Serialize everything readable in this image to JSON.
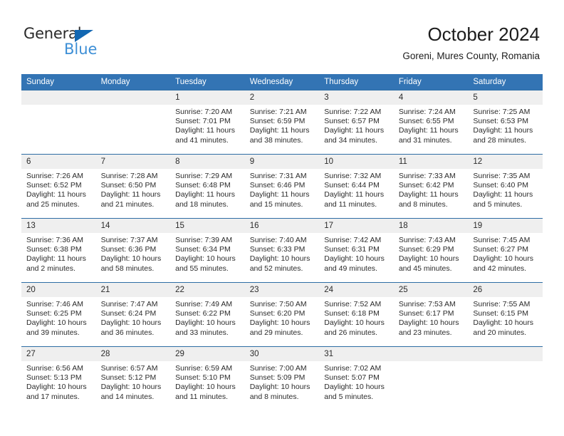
{
  "brand": {
    "name_part1": "General",
    "name_part2": "Blue",
    "triangle_color": "#1267b2",
    "blue_color": "#3d8fd6"
  },
  "header": {
    "title": "October 2024",
    "location": "Goreni, Mures County, Romania"
  },
  "theme": {
    "header_bg": "#3374b4",
    "row_border": "#2e6da4",
    "daynum_bg": "#efefef",
    "text": "#2b2b2b"
  },
  "weekday_headers": [
    "Sunday",
    "Monday",
    "Tuesday",
    "Wednesday",
    "Thursday",
    "Friday",
    "Saturday"
  ],
  "weeks": [
    [
      {
        "day": "",
        "lines": []
      },
      {
        "day": "",
        "lines": []
      },
      {
        "day": "1",
        "lines": [
          "Sunrise: 7:20 AM",
          "Sunset: 7:01 PM",
          "Daylight: 11 hours",
          "and 41 minutes."
        ]
      },
      {
        "day": "2",
        "lines": [
          "Sunrise: 7:21 AM",
          "Sunset: 6:59 PM",
          "Daylight: 11 hours",
          "and 38 minutes."
        ]
      },
      {
        "day": "3",
        "lines": [
          "Sunrise: 7:22 AM",
          "Sunset: 6:57 PM",
          "Daylight: 11 hours",
          "and 34 minutes."
        ]
      },
      {
        "day": "4",
        "lines": [
          "Sunrise: 7:24 AM",
          "Sunset: 6:55 PM",
          "Daylight: 11 hours",
          "and 31 minutes."
        ]
      },
      {
        "day": "5",
        "lines": [
          "Sunrise: 7:25 AM",
          "Sunset: 6:53 PM",
          "Daylight: 11 hours",
          "and 28 minutes."
        ]
      }
    ],
    [
      {
        "day": "6",
        "lines": [
          "Sunrise: 7:26 AM",
          "Sunset: 6:52 PM",
          "Daylight: 11 hours",
          "and 25 minutes."
        ]
      },
      {
        "day": "7",
        "lines": [
          "Sunrise: 7:28 AM",
          "Sunset: 6:50 PM",
          "Daylight: 11 hours",
          "and 21 minutes."
        ]
      },
      {
        "day": "8",
        "lines": [
          "Sunrise: 7:29 AM",
          "Sunset: 6:48 PM",
          "Daylight: 11 hours",
          "and 18 minutes."
        ]
      },
      {
        "day": "9",
        "lines": [
          "Sunrise: 7:31 AM",
          "Sunset: 6:46 PM",
          "Daylight: 11 hours",
          "and 15 minutes."
        ]
      },
      {
        "day": "10",
        "lines": [
          "Sunrise: 7:32 AM",
          "Sunset: 6:44 PM",
          "Daylight: 11 hours",
          "and 11 minutes."
        ]
      },
      {
        "day": "11",
        "lines": [
          "Sunrise: 7:33 AM",
          "Sunset: 6:42 PM",
          "Daylight: 11 hours",
          "and 8 minutes."
        ]
      },
      {
        "day": "12",
        "lines": [
          "Sunrise: 7:35 AM",
          "Sunset: 6:40 PM",
          "Daylight: 11 hours",
          "and 5 minutes."
        ]
      }
    ],
    [
      {
        "day": "13",
        "lines": [
          "Sunrise: 7:36 AM",
          "Sunset: 6:38 PM",
          "Daylight: 11 hours",
          "and 2 minutes."
        ]
      },
      {
        "day": "14",
        "lines": [
          "Sunrise: 7:37 AM",
          "Sunset: 6:36 PM",
          "Daylight: 10 hours",
          "and 58 minutes."
        ]
      },
      {
        "day": "15",
        "lines": [
          "Sunrise: 7:39 AM",
          "Sunset: 6:34 PM",
          "Daylight: 10 hours",
          "and 55 minutes."
        ]
      },
      {
        "day": "16",
        "lines": [
          "Sunrise: 7:40 AM",
          "Sunset: 6:33 PM",
          "Daylight: 10 hours",
          "and 52 minutes."
        ]
      },
      {
        "day": "17",
        "lines": [
          "Sunrise: 7:42 AM",
          "Sunset: 6:31 PM",
          "Daylight: 10 hours",
          "and 49 minutes."
        ]
      },
      {
        "day": "18",
        "lines": [
          "Sunrise: 7:43 AM",
          "Sunset: 6:29 PM",
          "Daylight: 10 hours",
          "and 45 minutes."
        ]
      },
      {
        "day": "19",
        "lines": [
          "Sunrise: 7:45 AM",
          "Sunset: 6:27 PM",
          "Daylight: 10 hours",
          "and 42 minutes."
        ]
      }
    ],
    [
      {
        "day": "20",
        "lines": [
          "Sunrise: 7:46 AM",
          "Sunset: 6:25 PM",
          "Daylight: 10 hours",
          "and 39 minutes."
        ]
      },
      {
        "day": "21",
        "lines": [
          "Sunrise: 7:47 AM",
          "Sunset: 6:24 PM",
          "Daylight: 10 hours",
          "and 36 minutes."
        ]
      },
      {
        "day": "22",
        "lines": [
          "Sunrise: 7:49 AM",
          "Sunset: 6:22 PM",
          "Daylight: 10 hours",
          "and 33 minutes."
        ]
      },
      {
        "day": "23",
        "lines": [
          "Sunrise: 7:50 AM",
          "Sunset: 6:20 PM",
          "Daylight: 10 hours",
          "and 29 minutes."
        ]
      },
      {
        "day": "24",
        "lines": [
          "Sunrise: 7:52 AM",
          "Sunset: 6:18 PM",
          "Daylight: 10 hours",
          "and 26 minutes."
        ]
      },
      {
        "day": "25",
        "lines": [
          "Sunrise: 7:53 AM",
          "Sunset: 6:17 PM",
          "Daylight: 10 hours",
          "and 23 minutes."
        ]
      },
      {
        "day": "26",
        "lines": [
          "Sunrise: 7:55 AM",
          "Sunset: 6:15 PM",
          "Daylight: 10 hours",
          "and 20 minutes."
        ]
      }
    ],
    [
      {
        "day": "27",
        "lines": [
          "Sunrise: 6:56 AM",
          "Sunset: 5:13 PM",
          "Daylight: 10 hours",
          "and 17 minutes."
        ]
      },
      {
        "day": "28",
        "lines": [
          "Sunrise: 6:57 AM",
          "Sunset: 5:12 PM",
          "Daylight: 10 hours",
          "and 14 minutes."
        ]
      },
      {
        "day": "29",
        "lines": [
          "Sunrise: 6:59 AM",
          "Sunset: 5:10 PM",
          "Daylight: 10 hours",
          "and 11 minutes."
        ]
      },
      {
        "day": "30",
        "lines": [
          "Sunrise: 7:00 AM",
          "Sunset: 5:09 PM",
          "Daylight: 10 hours",
          "and 8 minutes."
        ]
      },
      {
        "day": "31",
        "lines": [
          "Sunrise: 7:02 AM",
          "Sunset: 5:07 PM",
          "Daylight: 10 hours",
          "and 5 minutes."
        ]
      },
      {
        "day": "",
        "lines": []
      },
      {
        "day": "",
        "lines": []
      }
    ]
  ]
}
